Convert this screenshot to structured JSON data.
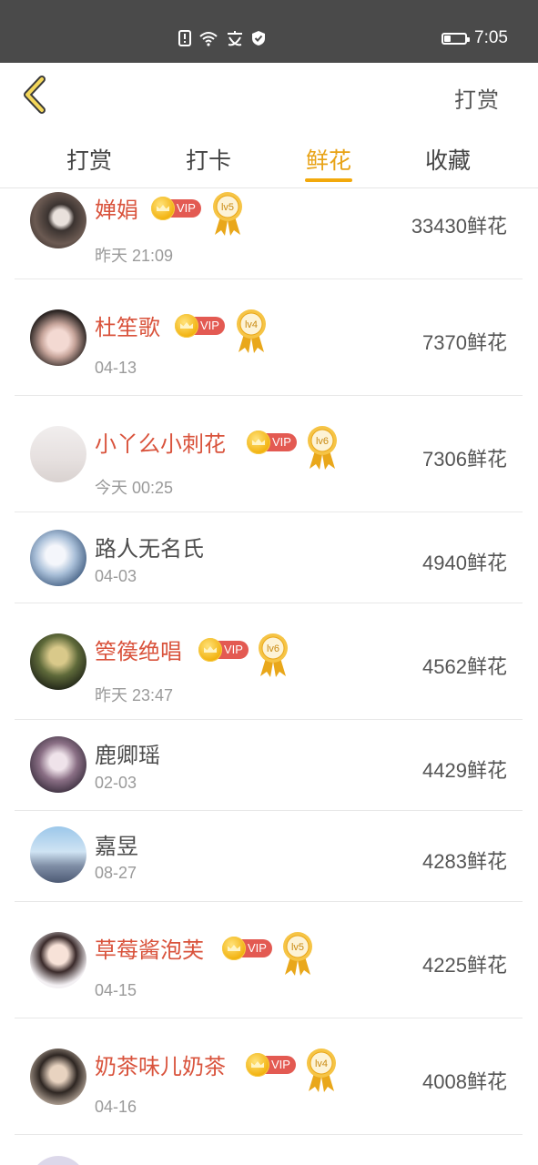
{
  "status_bar": {
    "time": "7:05",
    "icons": [
      "alert-icon",
      "wifi-icon",
      "pay-icon",
      "shield-icon",
      "battery-icon"
    ],
    "battery_level": 0.3
  },
  "header": {
    "back_icon": "chevron-left-icon",
    "action_label": "打赏"
  },
  "tabs": [
    {
      "label": "打赏",
      "active": false
    },
    {
      "label": "打卡",
      "active": false
    },
    {
      "label": "鲜花",
      "active": true
    },
    {
      "label": "收藏",
      "active": false
    }
  ],
  "colors": {
    "accent": "#f2a90c",
    "vip_name": "#d9533c",
    "vip_badge": "#e35a52",
    "status_bar": "#4a4a4a"
  },
  "vip_label": "VIP",
  "users": [
    {
      "name": "婵娟",
      "vip": true,
      "level": "lv5",
      "date": "昨天 21:09",
      "amount": "33430鲜花"
    },
    {
      "name": "杜笙歌",
      "vip": true,
      "level": "lv4",
      "date": "04-13",
      "amount": "7370鲜花"
    },
    {
      "name": "小丫么小刺花",
      "vip": true,
      "level": "lv6",
      "date": "今天 00:25",
      "amount": "7306鲜花"
    },
    {
      "name": "路人无名氏",
      "vip": false,
      "level": "",
      "date": "04-03",
      "amount": "4940鲜花"
    },
    {
      "name": "箜篌绝唱",
      "vip": true,
      "level": "lv6",
      "date": "昨天 23:47",
      "amount": "4562鲜花"
    },
    {
      "name": "鹿卿瑶",
      "vip": false,
      "level": "",
      "date": "02-03",
      "amount": "4429鲜花"
    },
    {
      "name": "嘉昱",
      "vip": false,
      "level": "",
      "date": "08-27",
      "amount": "4283鲜花"
    },
    {
      "name": "草莓酱泡芙",
      "vip": true,
      "level": "lv5",
      "date": "04-15",
      "amount": "4225鲜花"
    },
    {
      "name": "奶茶味儿奶茶",
      "vip": true,
      "level": "lv4",
      "date": "04-16",
      "amount": "4008鲜花"
    }
  ]
}
